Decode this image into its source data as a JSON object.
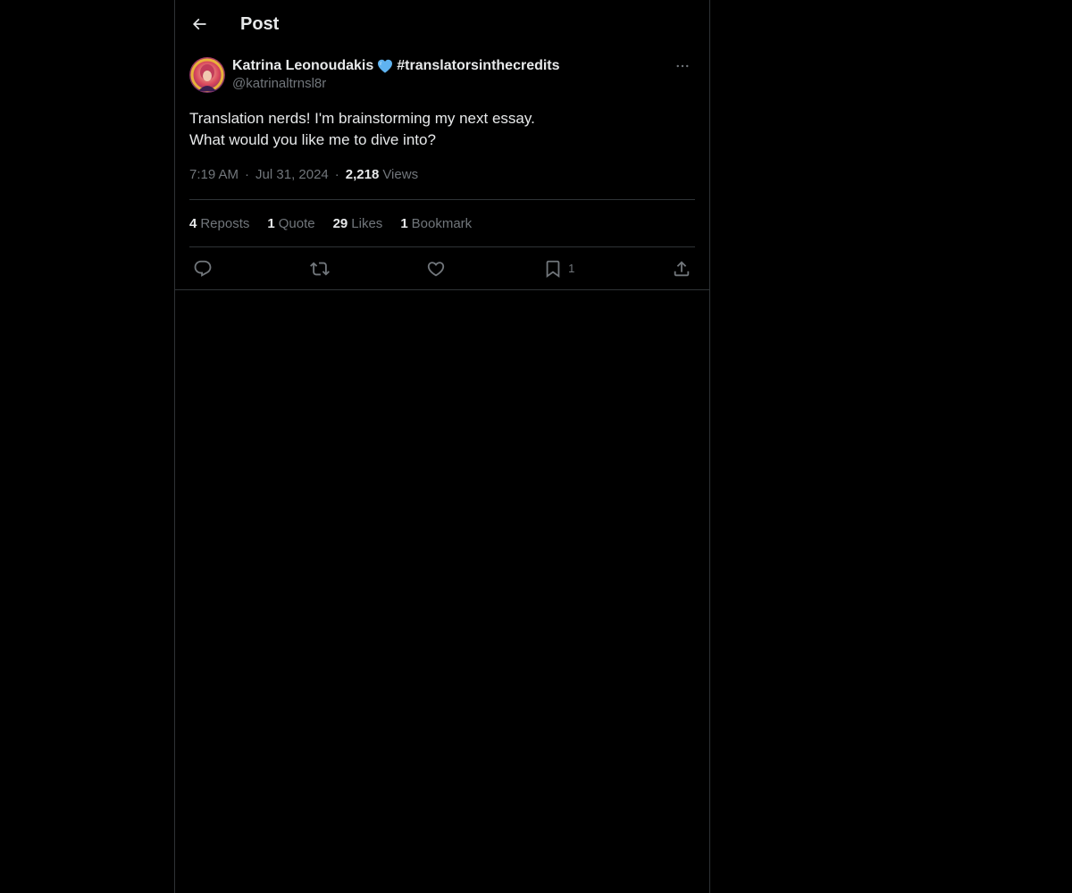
{
  "header": {
    "title": "Post"
  },
  "author": {
    "name": "Katrina Leonoudakis",
    "hashtag": "#translatorsinthecredits",
    "handle": "@katrinaltrnsl8r"
  },
  "post": {
    "lines": [
      "Translation nerds! I'm brainstorming my next essay.",
      "What would you like me to dive into?"
    ],
    "time": "7:19 AM",
    "date": "Jul 31, 2024",
    "views_count": "2,218",
    "views_label": "Views",
    "separator": "·"
  },
  "stats": {
    "reposts": {
      "count": "4",
      "label": "Reposts"
    },
    "quotes": {
      "count": "1",
      "label": "Quote"
    },
    "likes": {
      "count": "29",
      "label": "Likes"
    },
    "bookmarks": {
      "count": "1",
      "label": "Bookmark"
    }
  },
  "actions": {
    "bookmark_count": "1"
  },
  "icons": {
    "back": "arrow-left-icon",
    "more": "more-horizontal-icon",
    "reply": "reply-icon",
    "repost": "repost-icon",
    "like": "heart-icon",
    "bookmark": "bookmark-icon",
    "share": "share-icon",
    "emoji": "blue-heart-emoji"
  },
  "colors": {
    "background": "#000000",
    "text_primary": "#e7e9ea",
    "text_secondary": "#71767b",
    "border": "#2f3336",
    "blue_heart": "#5fb3f0"
  }
}
